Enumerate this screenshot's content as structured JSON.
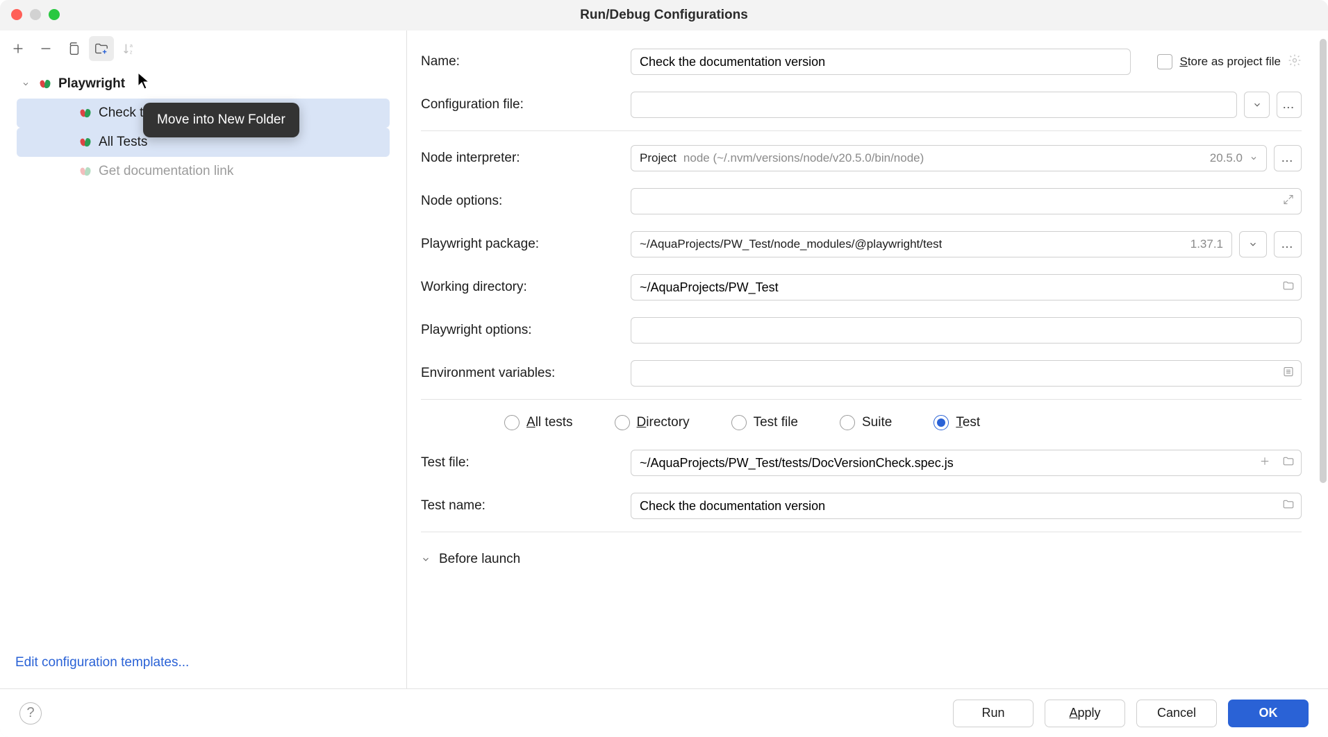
{
  "title": "Run/Debug Configurations",
  "tooltip": "Move into New Folder",
  "sidebar": {
    "group_label": "Playwright",
    "items": [
      {
        "label": "Check the documentation version",
        "selected": true,
        "dim": false
      },
      {
        "label": "All Tests",
        "selected": true,
        "dim": false
      },
      {
        "label": "Get documentation link",
        "selected": false,
        "dim": true
      }
    ],
    "edit_templates": "Edit configuration templates..."
  },
  "form": {
    "name_label": "Name:",
    "name_value": "Check the documentation version",
    "store_as_label_prefix": "S",
    "store_as_label_rest": "tore as project file",
    "config_file_label": "Configuration file:",
    "config_file_value": "",
    "node_interpreter_label": "Node interpreter:",
    "node_interpreter_primary": "Project",
    "node_interpreter_secondary": "node (~/.nvm/versions/node/v20.5.0/bin/node)",
    "node_interpreter_version": "20.5.0",
    "node_options_label": "Node options:",
    "node_options_value": "",
    "playwright_package_label": "Playwright package:",
    "playwright_package_value": "~/AquaProjects/PW_Test/node_modules/@playwright/test",
    "playwright_package_version": "1.37.1",
    "working_dir_label": "Working directory:",
    "working_dir_value": "~/AquaProjects/PW_Test",
    "playwright_options_label": "Playwright options:",
    "playwright_options_value": "",
    "env_vars_label": "Environment variables:",
    "env_vars_value": "",
    "radios": {
      "all_tests": "All tests",
      "directory": "Directory",
      "test_file": "Test file",
      "suite": "Suite",
      "test": "Test",
      "selected": "test"
    },
    "test_file_label": "Test file:",
    "test_file_value": "~/AquaProjects/PW_Test/tests/DocVersionCheck.spec.js",
    "test_name_label": "Test name:",
    "test_name_value": "Check the documentation version",
    "before_launch": "Before launch"
  },
  "footer": {
    "run": "Run",
    "apply": "Apply",
    "cancel": "Cancel",
    "ok": "OK"
  }
}
